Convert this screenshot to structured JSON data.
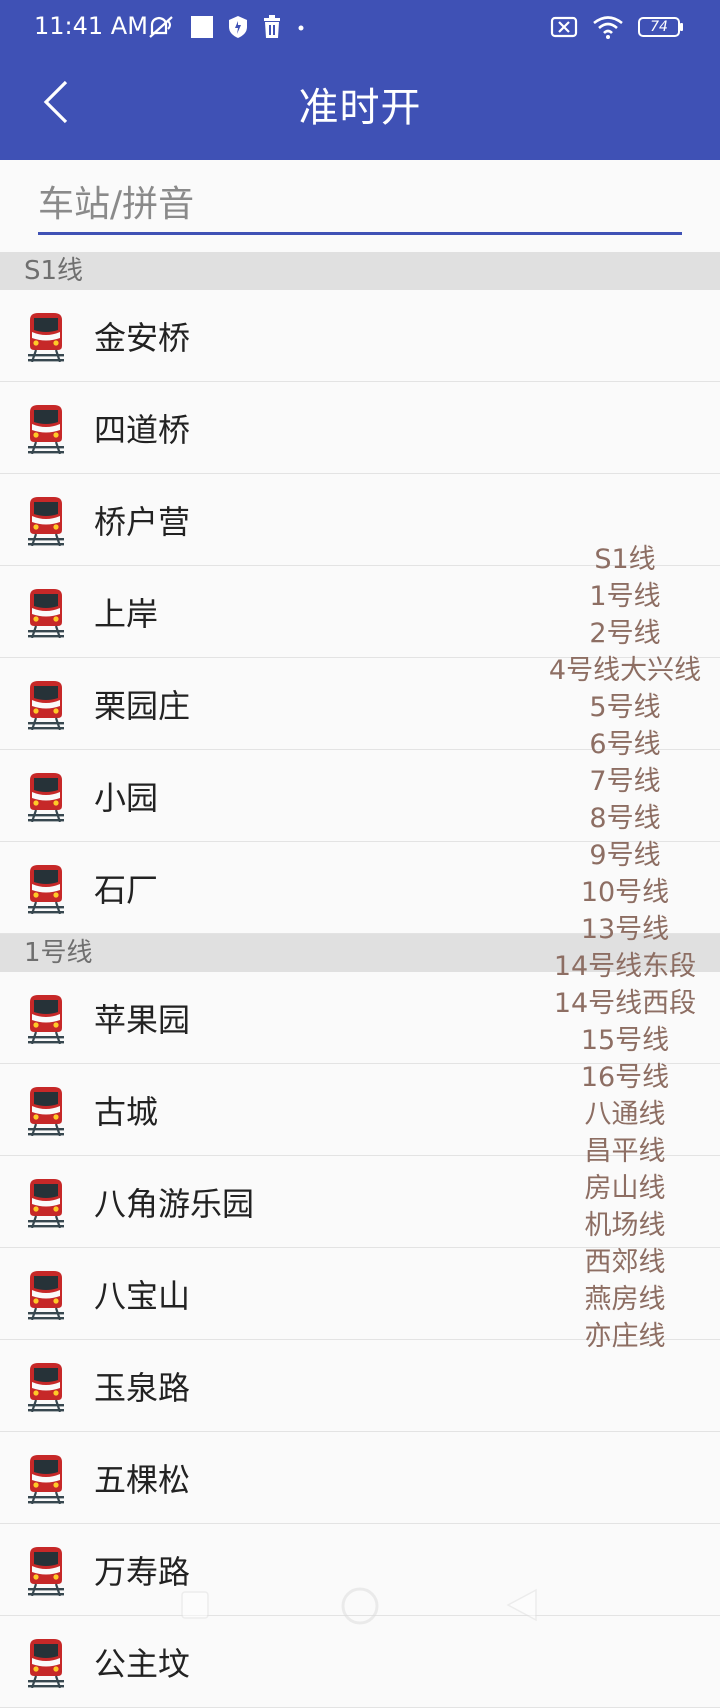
{
  "status": {
    "time": "11:41 AM",
    "battery": "74"
  },
  "app": {
    "title": "准时开"
  },
  "search": {
    "placeholder": "车站/拼音"
  },
  "sections": [
    {
      "title": "S1线",
      "stations": [
        "金安桥",
        "四道桥",
        "桥户营",
        "上岸",
        "栗园庄",
        "小园",
        "石厂"
      ]
    },
    {
      "title": "1号线",
      "stations": [
        "苹果园",
        "古城",
        "八角游乐园",
        "八宝山",
        "玉泉路",
        "五棵松",
        "万寿路",
        "公主坟"
      ]
    }
  ],
  "index_bar": [
    "S1线",
    "1号线",
    "2号线",
    "4号线大兴线",
    "5号线",
    "6号线",
    "7号线",
    "8号线",
    "9号线",
    "10号线",
    "13号线",
    "14号线东段",
    "14号线西段",
    "15号线",
    "16号线",
    "八通线",
    "昌平线",
    "房山线",
    "机场线",
    "西郊线",
    "燕房线",
    "亦庄线"
  ],
  "icons": {
    "station_row": "train-icon",
    "back": "back-arrow-icon"
  },
  "colors": {
    "primary": "#3f51b5",
    "index_text": "#8d6e63",
    "section_bg": "#e0e0e0"
  }
}
